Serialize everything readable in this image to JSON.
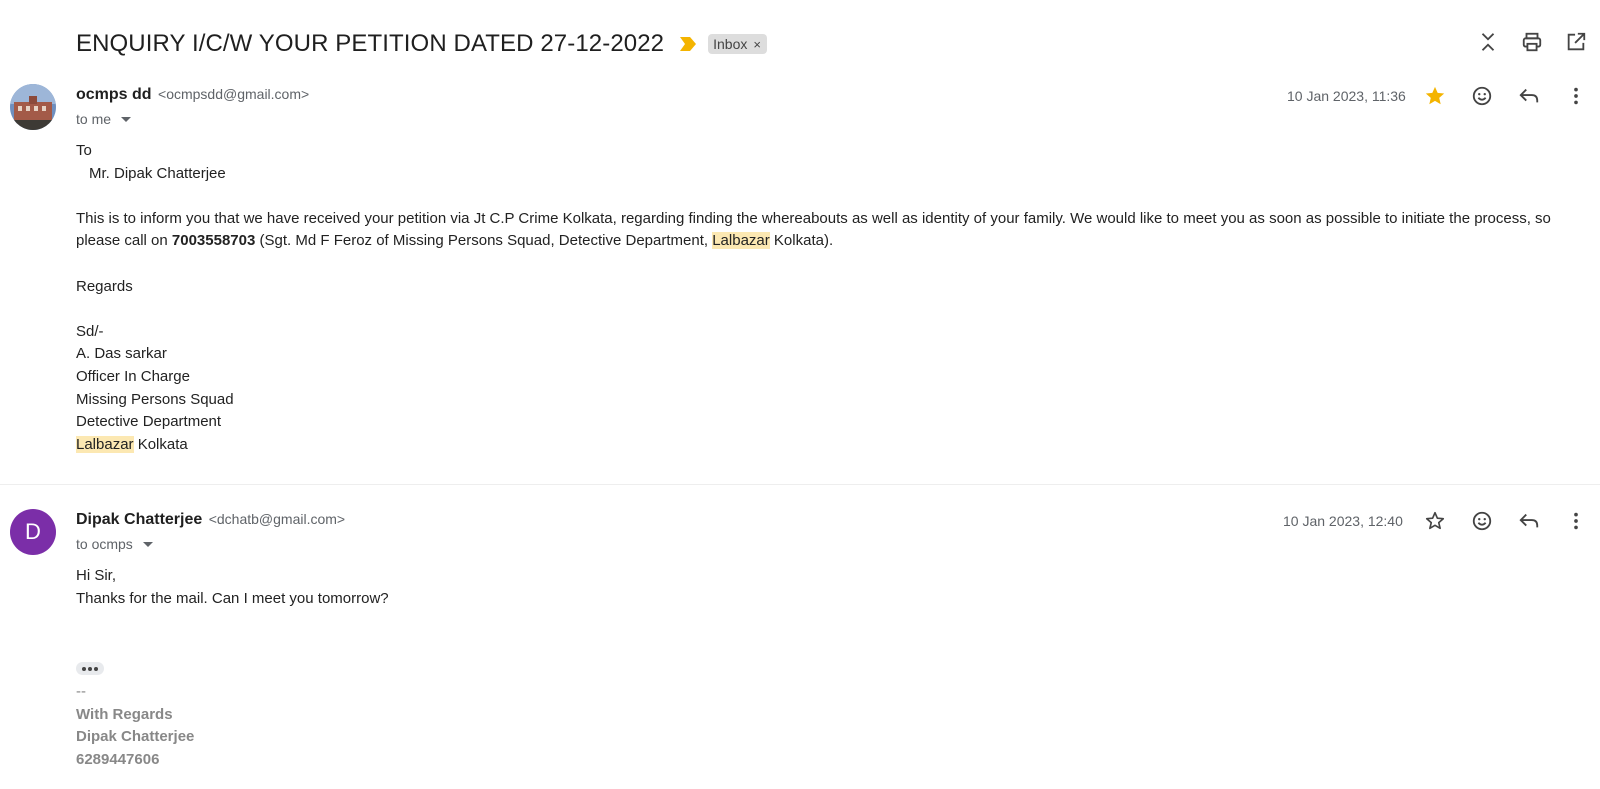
{
  "thread": {
    "subject": "ENQUIRY I/C/W YOUR PETITION DATED 27-12-2022",
    "label": "Inbox",
    "label_close": "×"
  },
  "message1": {
    "sender_name": "ocmps dd",
    "sender_email": "<ocmpsdd@gmail.com>",
    "to": "to me",
    "date": "10 Jan 2023, 11:36",
    "starred": true,
    "body": {
      "to_line": "To",
      "recipient": "Mr. Dipak Chatterjee",
      "para_part1": "This is to inform you that we have received your petition via Jt C.P Crime Kolkata, regarding finding the whereabouts as well as identity of your family. We would like to meet you as soon as possible to initiate the process, so please call on ",
      "phone": "7003558703",
      "para_part2": " (Sgt. Md F Feroz of Missing Persons Squad, Detective Department, ",
      "highlight1": "Lalbazar",
      "para_part3": " Kolkata).",
      "regards": "Regards",
      "sd": "Sd/-",
      "sig_name": "A. Das sarkar",
      "sig_title": "Officer In Charge",
      "sig_unit": "Missing Persons Squad",
      "sig_dept": "Detective Department",
      "highlight2": "Lalbazar",
      "sig_city": " Kolkata"
    }
  },
  "message2": {
    "avatar_letter": "D",
    "sender_name": "Dipak Chatterjee",
    "sender_email": "<dchatb@gmail.com>",
    "to": "to ocmps",
    "date": "10 Jan 2023, 12:40",
    "starred": false,
    "body": {
      "greeting": "Hi Sir,",
      "line1": "Thanks for the mail. Can I meet you tomorrow?"
    },
    "signature": {
      "dashes": "--",
      "regards": "With Regards",
      "name": "Dipak Chatterjee",
      "phone": "6289447606"
    }
  },
  "colors": {
    "star_filled": "#f4b400",
    "importance_marker": "#f4b400",
    "highlight": "#fce8b2",
    "avatar_purple": "#7b2ea8"
  }
}
